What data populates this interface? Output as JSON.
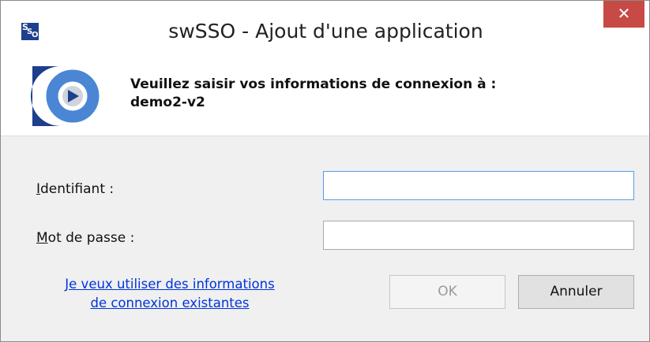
{
  "window": {
    "title": "swSSO - Ajout d'une application",
    "close_glyph": "✕",
    "icon": "swsso-app-icon",
    "icon_letters": [
      "S",
      "S",
      "O"
    ]
  },
  "header": {
    "logo": "swsso-logo",
    "prompt_line1": "Veuillez saisir vos informations de connexion à :",
    "prompt_line2": "demo2-v2"
  },
  "form": {
    "username": {
      "label_accel": "I",
      "label_rest": "dentifiant :",
      "value": ""
    },
    "password": {
      "label_accel": "M",
      "label_rest": "ot de passe :",
      "value": ""
    }
  },
  "footer": {
    "link_line1": "Je veux utiliser des informations",
    "link_line2": "de connexion existantes",
    "ok_label": "OK",
    "cancel_label": "Annuler"
  },
  "colors": {
    "close_bg": "#c74a45",
    "link": "#0033dd",
    "logo_dark": "#1d3f8c",
    "logo_light": "#4a86d4",
    "focus_border": "#569de5"
  }
}
